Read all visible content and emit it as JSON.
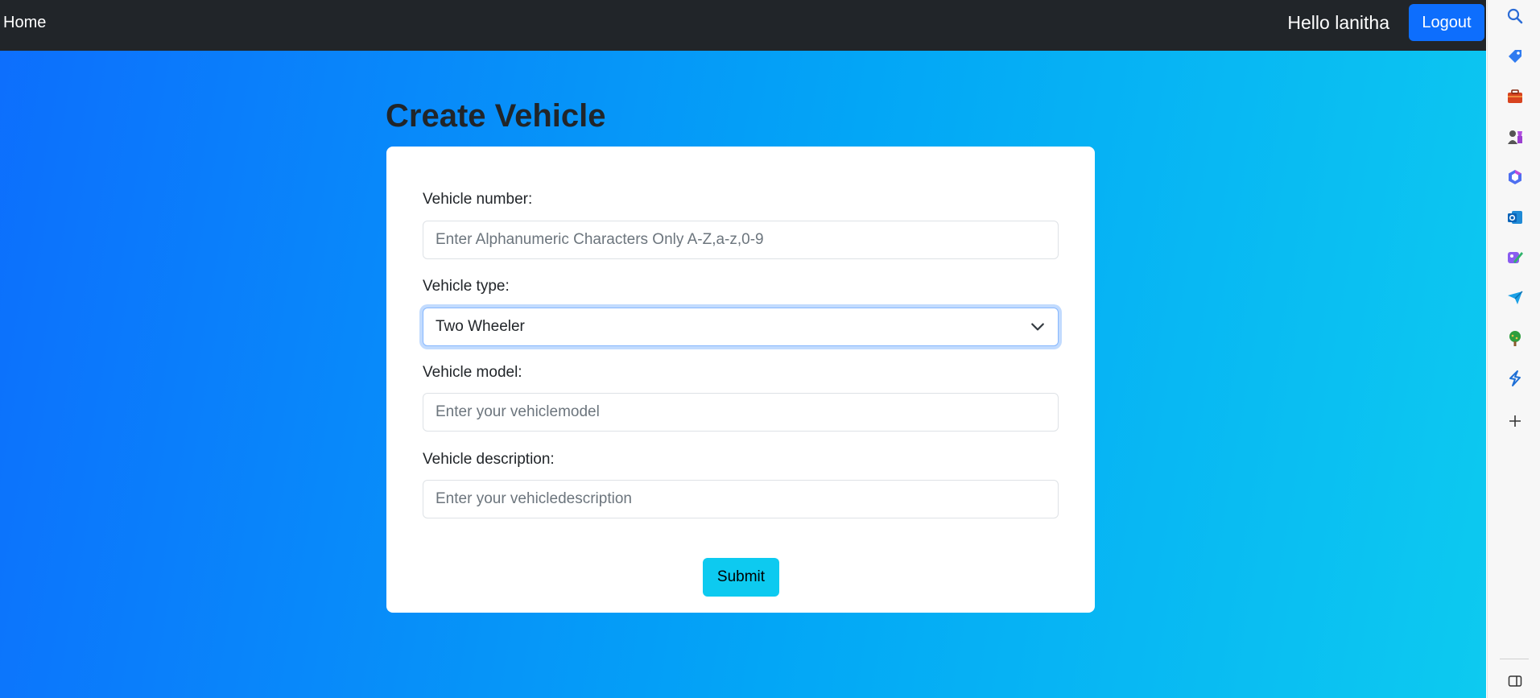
{
  "navbar": {
    "home_label": "Home",
    "greeting": "Hello lanitha",
    "logout_label": "Logout"
  },
  "form": {
    "title": "Create Vehicle",
    "vehicle_number": {
      "label": "Vehicle number:",
      "placeholder": "Enter Alphanumeric Characters Only A-Z,a-z,0-9",
      "value": ""
    },
    "vehicle_type": {
      "label": "Vehicle type:",
      "selected": "Two Wheeler"
    },
    "vehicle_model": {
      "label": "Vehicle model:",
      "placeholder": "Enter your vehiclemodel",
      "value": ""
    },
    "vehicle_description": {
      "label": "Vehicle description:",
      "placeholder": "Enter your vehicledescription",
      "value": ""
    },
    "submit_label": "Submit"
  },
  "sidebar": {
    "icons": [
      "search-icon",
      "tag-icon",
      "briefcase-icon",
      "chess-icon",
      "copilot-icon",
      "outlook-icon",
      "designer-icon",
      "send-icon",
      "tree-icon",
      "bolt-icon",
      "add-icon"
    ],
    "bottom_icon": "sidebar-toggle-icon"
  },
  "colors": {
    "navbar_bg": "#212529",
    "primary": "#0d6efd",
    "info": "#0dcaf0",
    "gradient_start": "#0d6efd",
    "gradient_end": "#0dcaf0"
  }
}
